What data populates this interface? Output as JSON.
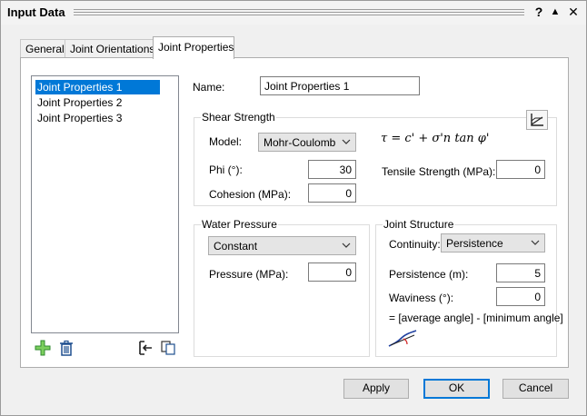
{
  "window": {
    "title": "Input Data",
    "help_label": "?",
    "collapse_label": "▲",
    "close_label": "✕"
  },
  "tabs": [
    {
      "label": "General"
    },
    {
      "label": "Joint Orientations"
    },
    {
      "label": "Joint Properties"
    }
  ],
  "joint_list": {
    "items": [
      "Joint Properties 1",
      "Joint Properties 2",
      "Joint Properties 3"
    ],
    "selected_index": 0
  },
  "name": {
    "label": "Name:",
    "value": "Joint Properties 1"
  },
  "shear_strength": {
    "title": "Shear Strength",
    "model_label": "Model:",
    "model_value": "Mohr-Coulomb",
    "phi_label": "Phi (°):",
    "phi_value": "30",
    "cohesion_label": "Cohesion (MPa):",
    "cohesion_value": "0",
    "tensile_label": "Tensile Strength (MPa):",
    "tensile_value": "0",
    "formula": "τ = c' + σ'n tan φ'"
  },
  "water_pressure": {
    "title": "Water Pressure",
    "mode_value": "Constant",
    "pressure_label": "Pressure (MPa):",
    "pressure_value": "0"
  },
  "joint_structure": {
    "title": "Joint Structure",
    "continuity_label": "Continuity:",
    "continuity_value": "Persistence",
    "persistence_label": "Persistence (m):",
    "persistence_value": "5",
    "waviness_label": "Waviness (°):",
    "waviness_value": "0",
    "waviness_note": "= [average angle] - [minimum angle]"
  },
  "buttons": {
    "apply": "Apply",
    "ok": "OK",
    "cancel": "Cancel"
  },
  "colors": {
    "selection": "#0078d7",
    "add_icon": "#3aa63a",
    "delete_icon": "#1f4f8f"
  }
}
